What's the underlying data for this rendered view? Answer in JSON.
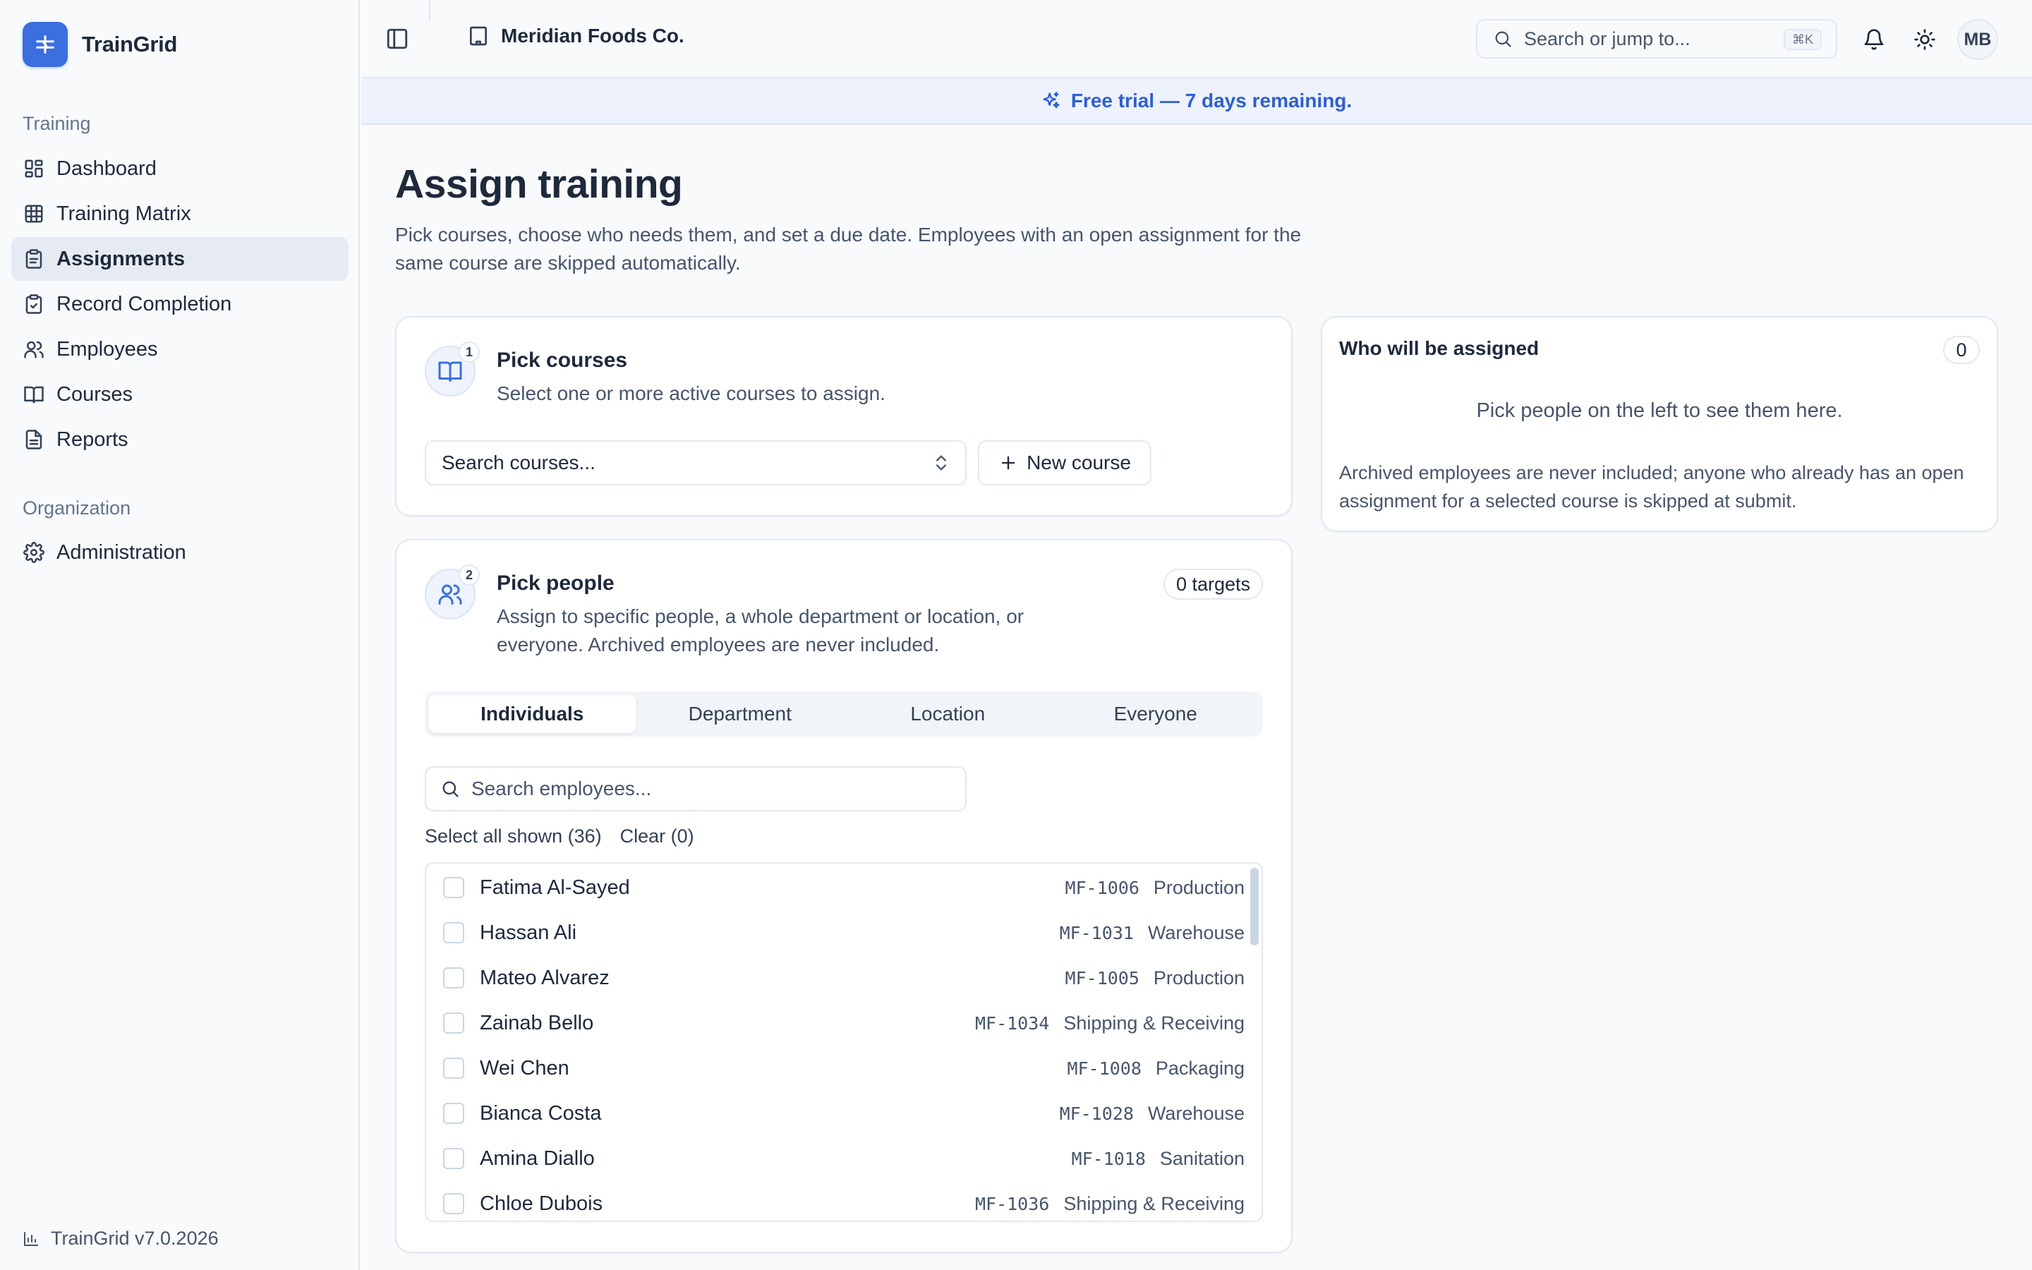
{
  "app": {
    "name": "TrainGrid",
    "version": "TrainGrid v7.0.2026"
  },
  "sidebar": {
    "sections": [
      {
        "label": "Training"
      },
      {
        "label": "Organization"
      }
    ],
    "items": [
      {
        "label": "Dashboard",
        "icon": "dashboard-icon"
      },
      {
        "label": "Training Matrix",
        "icon": "grid-icon"
      },
      {
        "label": "Assignments",
        "icon": "clipboard-icon",
        "active": true
      },
      {
        "label": "Record Completion",
        "icon": "clipboard-check-icon"
      },
      {
        "label": "Employees",
        "icon": "users-icon"
      },
      {
        "label": "Courses",
        "icon": "book-icon"
      },
      {
        "label": "Reports",
        "icon": "file-text-icon"
      },
      {
        "label": "Administration",
        "icon": "gear-icon"
      }
    ]
  },
  "topbar": {
    "org_name": "Meridian Foods Co.",
    "search_placeholder": "Search or jump to...",
    "search_shortcut": "⌘K",
    "avatar_initials": "MB"
  },
  "banner": {
    "text": "Free trial — 7 days remaining."
  },
  "page": {
    "title": "Assign training",
    "description": "Pick courses, choose who needs them, and set a due date. Employees with an open assignment for the same course are skipped automatically."
  },
  "courses_card": {
    "step": "1",
    "title": "Pick courses",
    "description": "Select one or more active courses to assign.",
    "search_placeholder": "Search courses...",
    "new_course_label": "New course"
  },
  "people_card": {
    "step": "2",
    "title": "Pick people",
    "description": "Assign to specific people, a whole department or location, or everyone. Archived employees are never included.",
    "targets_label": "0 targets",
    "tabs": [
      {
        "label": "Individuals",
        "active": true
      },
      {
        "label": "Department"
      },
      {
        "label": "Location"
      },
      {
        "label": "Everyone"
      }
    ],
    "search_placeholder": "Search employees...",
    "select_all_label": "Select all shown (36)",
    "clear_label": "Clear (0)",
    "employees": [
      {
        "name": "Fatima Al-Sayed",
        "id": "MF-1006",
        "department": "Production"
      },
      {
        "name": "Hassan Ali",
        "id": "MF-1031",
        "department": "Warehouse"
      },
      {
        "name": "Mateo Alvarez",
        "id": "MF-1005",
        "department": "Production"
      },
      {
        "name": "Zainab Bello",
        "id": "MF-1034",
        "department": "Shipping & Receiving"
      },
      {
        "name": "Wei Chen",
        "id": "MF-1008",
        "department": "Packaging"
      },
      {
        "name": "Bianca Costa",
        "id": "MF-1028",
        "department": "Warehouse"
      },
      {
        "name": "Amina Diallo",
        "id": "MF-1018",
        "department": "Sanitation"
      },
      {
        "name": "Chloe Dubois",
        "id": "MF-1036",
        "department": "Shipping & Receiving"
      }
    ]
  },
  "assign_panel": {
    "title": "Who will be assigned",
    "count": "0",
    "empty_text": "Pick people on the left to see them here.",
    "note": "Archived employees are never included; anyone who already has an open assignment for a selected course is skipped at submit."
  },
  "colors": {
    "accent": "#3b6fe0",
    "banner_text": "#2f5fd0",
    "banner_bg": "#edf2fc"
  }
}
